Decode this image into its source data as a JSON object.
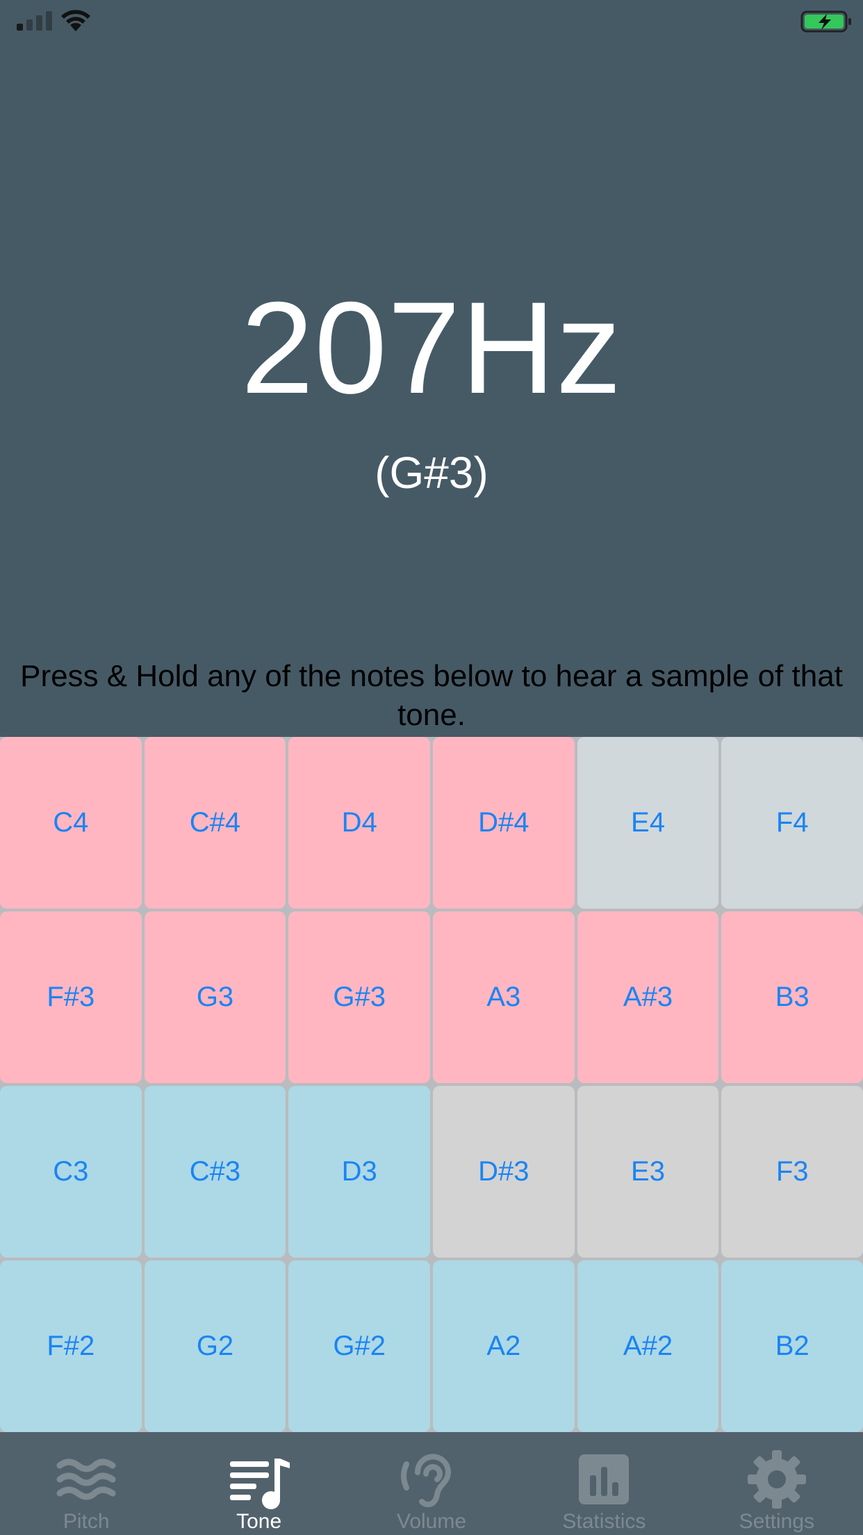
{
  "status_bar": {
    "signal_icon": "signal-icon",
    "wifi_icon": "wifi-icon",
    "battery_icon": "battery-charging-icon",
    "battery_color": "#34c759"
  },
  "display": {
    "frequency": "207Hz",
    "note": "(G#3)"
  },
  "instructions": "Press & Hold any of the notes below to hear a sample of that tone.",
  "colors": {
    "pink": "#ffb6c1",
    "light_gray": "#d0d8dc",
    "light_blue": "#add8e6",
    "gray": "#d3d3d3",
    "label_blue": "#1a84f3"
  },
  "keys": [
    {
      "label": "C4",
      "color": "pink"
    },
    {
      "label": "C#4",
      "color": "pink"
    },
    {
      "label": "D4",
      "color": "pink"
    },
    {
      "label": "D#4",
      "color": "pink"
    },
    {
      "label": "E4",
      "color": "light_gray"
    },
    {
      "label": "F4",
      "color": "light_gray"
    },
    {
      "label": "F#3",
      "color": "pink"
    },
    {
      "label": "G3",
      "color": "pink"
    },
    {
      "label": "G#3",
      "color": "pink"
    },
    {
      "label": "A3",
      "color": "pink"
    },
    {
      "label": "A#3",
      "color": "pink"
    },
    {
      "label": "B3",
      "color": "pink"
    },
    {
      "label": "C3",
      "color": "light_blue"
    },
    {
      "label": "C#3",
      "color": "light_blue"
    },
    {
      "label": "D3",
      "color": "light_blue"
    },
    {
      "label": "D#3",
      "color": "gray"
    },
    {
      "label": "E3",
      "color": "gray"
    },
    {
      "label": "F3",
      "color": "gray"
    },
    {
      "label": "F#2",
      "color": "light_blue"
    },
    {
      "label": "G2",
      "color": "light_blue"
    },
    {
      "label": "G#2",
      "color": "light_blue"
    },
    {
      "label": "A2",
      "color": "light_blue"
    },
    {
      "label": "A#2",
      "color": "light_blue"
    },
    {
      "label": "B2",
      "color": "light_blue"
    }
  ],
  "tabs": [
    {
      "label": "Pitch",
      "icon": "waves-icon",
      "active": false
    },
    {
      "label": "Tone",
      "icon": "music-list-icon",
      "active": true
    },
    {
      "label": "Volume",
      "icon": "ear-icon",
      "active": false
    },
    {
      "label": "Statistics",
      "icon": "bar-chart-icon",
      "active": false
    },
    {
      "label": "Settings",
      "icon": "gear-icon",
      "active": false
    }
  ]
}
